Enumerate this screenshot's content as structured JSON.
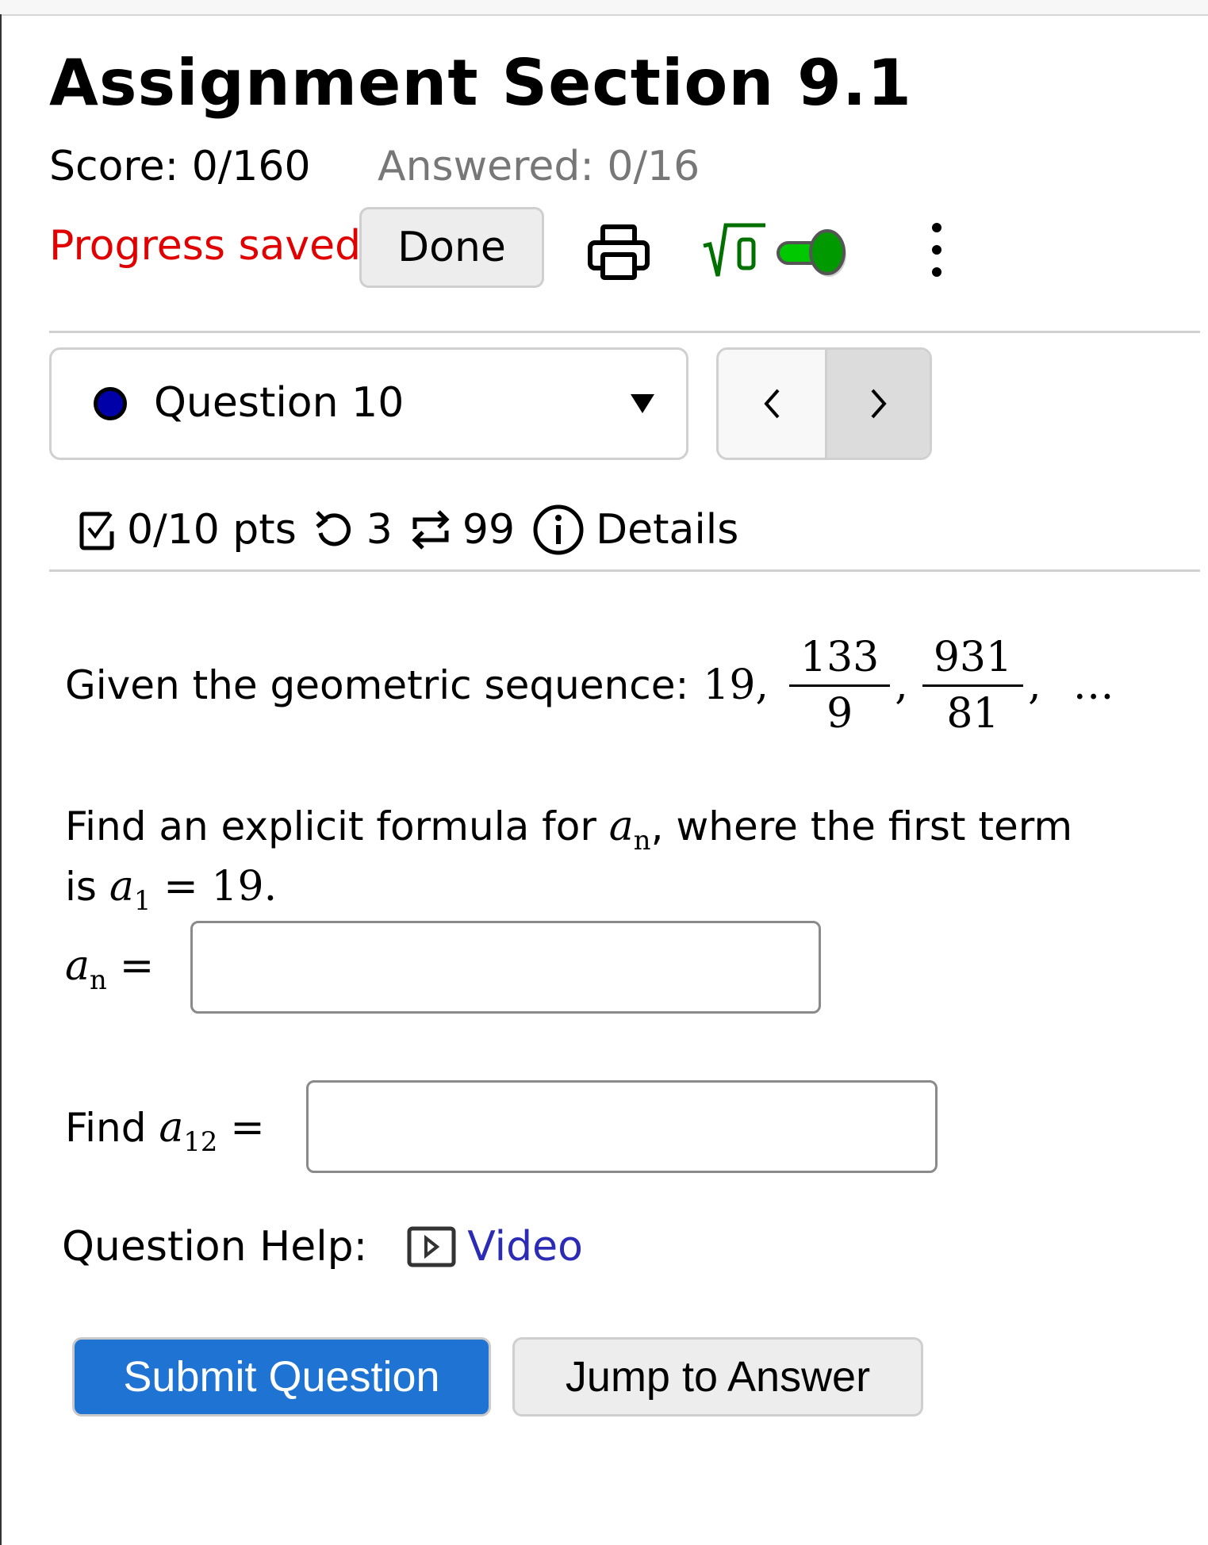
{
  "header": {
    "title": "Assignment Section 9.1",
    "score": "Score: 0/160",
    "answered": "Answered: 0/16"
  },
  "toolbar": {
    "progress_status": "Progress saved",
    "done_label": "Done",
    "print_icon": "printer-icon",
    "math_icon": "sqrt-0-icon",
    "math_toggle_on": true,
    "more_icon": "vertical-dots-icon"
  },
  "question_nav": {
    "selected": "Question 10",
    "status_dot_color": "#0000a8",
    "prev_label": "<",
    "next_label": ">"
  },
  "meta": {
    "points": "0/10 pts",
    "retries": "3",
    "versions": "99",
    "details_label": "Details"
  },
  "question": {
    "intro": "Given the geometric sequence:",
    "first_term": "19,",
    "term2": {
      "num": "133",
      "den": "9"
    },
    "term3": {
      "num": "931",
      "den": "81"
    },
    "comma": ",",
    "ellipsis": "…",
    "prompt_part1": "Find an explicit formula for",
    "prompt_var": "a",
    "prompt_sub": "n",
    "prompt_part2": ", where the first term",
    "prompt_line2_is": "is",
    "prompt_line2_var": "a",
    "prompt_line2_sub": "1",
    "prompt_line2_eq": "= 19.",
    "answer1_label_var": "a",
    "answer1_label_sub": "n",
    "answer1_label_eq": "=",
    "answer1_value": "",
    "answer2_prefix": "Find",
    "answer2_label_var": "a",
    "answer2_label_sub": "12",
    "answer2_label_eq": "=",
    "answer2_value": ""
  },
  "help": {
    "label": "Question Help:",
    "video_label": "Video"
  },
  "actions": {
    "submit_label": "Submit Question",
    "jump_label": "Jump to Answer"
  },
  "colors": {
    "progress_saved": "#e00000",
    "submit_bg": "#1f73d3",
    "link": "#2b2bb5",
    "toggle_on": "#009a00"
  }
}
